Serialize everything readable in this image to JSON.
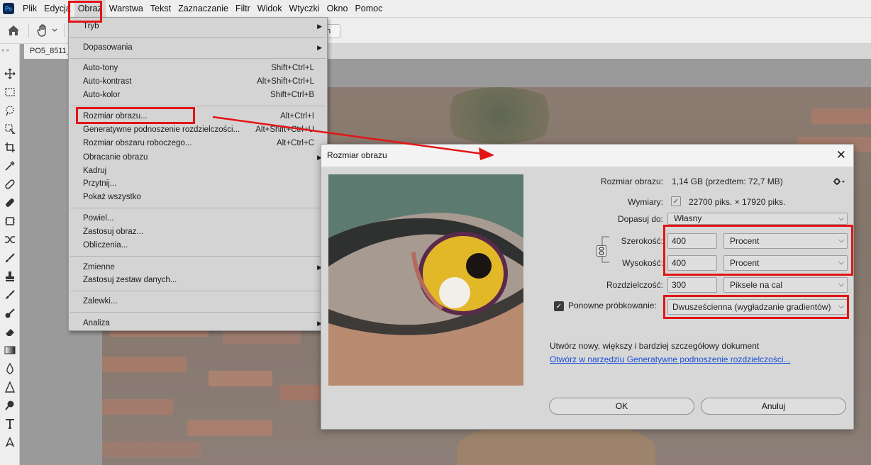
{
  "app": {
    "logo": "Ps",
    "menu": [
      "Plik",
      "Edycja",
      "Obraz",
      "Warstwa",
      "Tekst",
      "Zaznaczanie",
      "Filtr",
      "Widok",
      "Wtyczki",
      "Okno",
      "Pomoc"
    ],
    "active_menu": "Obraz"
  },
  "optionsbar": {
    "partial_button_text": "n"
  },
  "document": {
    "tab_title": "PO5_8511_"
  },
  "dropdown": {
    "items": [
      {
        "label": "Tryb",
        "shortcut": "",
        "submenu": true
      },
      {
        "label": "Dopasowania",
        "shortcut": "",
        "submenu": true
      },
      {
        "label": "Auto-tony",
        "shortcut": "Shift+Ctrl+L",
        "submenu": false
      },
      {
        "label": "Auto-kontrast",
        "shortcut": "Alt+Shift+Ctrl+L",
        "submenu": false
      },
      {
        "label": "Auto-kolor",
        "shortcut": "Shift+Ctrl+B",
        "submenu": false
      },
      {
        "label": "Rozmiar obrazu...",
        "shortcut": "Alt+Ctrl+I",
        "submenu": false
      },
      {
        "label": "Generatywne podnoszenie rozdzielczości...",
        "shortcut": "Alt+Shift+Ctrl+U",
        "submenu": false
      },
      {
        "label": "Rozmiar obszaru roboczego...",
        "shortcut": "Alt+Ctrl+C",
        "submenu": false
      },
      {
        "label": "Obracanie obrazu",
        "shortcut": "",
        "submenu": true
      },
      {
        "label": "Kadruj",
        "shortcut": "",
        "submenu": false
      },
      {
        "label": "Przytnij...",
        "shortcut": "",
        "submenu": false
      },
      {
        "label": "Pokaż wszystko",
        "shortcut": "",
        "submenu": false
      },
      {
        "label": "Powiel...",
        "shortcut": "",
        "submenu": false
      },
      {
        "label": "Zastosuj obraz...",
        "shortcut": "",
        "submenu": false
      },
      {
        "label": "Obliczenia...",
        "shortcut": "",
        "submenu": false
      },
      {
        "label": "Zmienne",
        "shortcut": "",
        "submenu": true
      },
      {
        "label": "Zastosuj zestaw danych...",
        "shortcut": "",
        "submenu": false
      },
      {
        "label": "Zalewki...",
        "shortcut": "",
        "submenu": false
      },
      {
        "label": "Analiza",
        "shortcut": "",
        "submenu": true
      }
    ]
  },
  "dialog": {
    "title": "Rozmiar obrazu",
    "image_size_label": "Rozmiar obrazu:",
    "image_size_value": "1,14 GB (przedtem: 72,7 MB)",
    "dimensions_label": "Wymiary:",
    "dimensions_value": "22700 piks. × 17920 piks.",
    "fit_to_label": "Dopasuj do:",
    "fit_to_value": "Własny",
    "width_label": "Szerokość:",
    "width_value": "400",
    "width_unit": "Procent",
    "height_label": "Wysokość:",
    "height_value": "400",
    "height_unit": "Procent",
    "resolution_label": "Rozdzielczość:",
    "resolution_value": "300",
    "resolution_unit": "Piksele na cal",
    "resample_label": "Ponowne próbkowanie:",
    "resample_checked": true,
    "resample_value": "Dwusześcienna (wygładzanie gradientów)",
    "info_text": "Utwórz nowy, większy i bardziej szczegółowy dokument",
    "link_text": "Otwórz w narzędziu Generatywne podnoszenie rozdzielczości...",
    "ok_label": "OK",
    "cancel_label": "Anuluj"
  },
  "colors": {
    "highlight": "#e31414",
    "link": "#1a4fd6",
    "dialog_bg": "#d7d7d7",
    "menu_bg": "#d4d4d4",
    "eye_iris": "#e2b728"
  }
}
